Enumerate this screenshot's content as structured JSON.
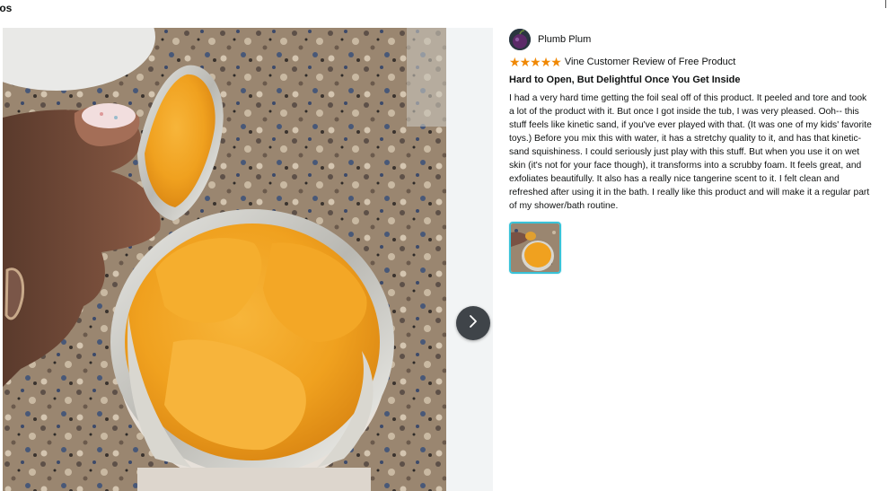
{
  "section": {
    "title": "otos"
  },
  "photo": {
    "alt_semantic": "product-photo"
  },
  "navigation": {
    "next_icon": "chevron-right-icon"
  },
  "review": {
    "reviewer_name": "Plumb Plum",
    "avatar_icon": "plum-avatar",
    "rating": 5,
    "rating_max": 5,
    "star_color": "#f08804",
    "vine_label": "Vine Customer Review of Free Product",
    "title": "Hard to Open, But Delightful Once You Get Inside",
    "body": "I had a very hard time getting the foil seal off of this product. It peeled and tore and took a lot of the product with it. But once I got inside the tub, I was very pleased. Ooh-- this stuff feels like kinetic sand, if you've ever played with that. (It was one of my kids' favorite toys.) Before you mix this with water, it has a stretchy quality to it, and has that kinetic-sand squishiness. I could seriously just play with this stuff. But when you use it on wet skin (it's not for your face though), it transforms into a scrubby foam. It feels great, and exfoliates beautifully. It also has a really nice tangerine scent to it. I felt clean and refreshed after using it in the bath. I really like this product and will make it a regular part of my shower/bath routine.",
    "thumbnail_border_color": "#39c2d7"
  }
}
